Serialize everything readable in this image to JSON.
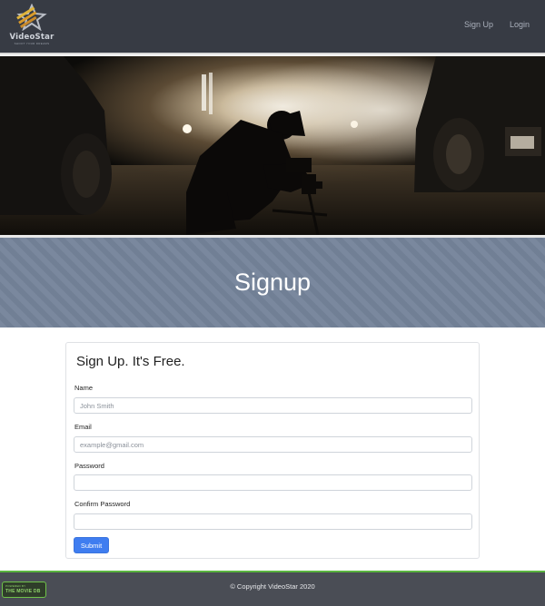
{
  "brand": {
    "name": "VideoStar",
    "tagline": "SHOOT YOUR DREAMS"
  },
  "nav": {
    "links": [
      {
        "label": "Sign Up"
      },
      {
        "label": "Login"
      }
    ]
  },
  "hero": {
    "image_description": "cameraman-kneeling-silhouette"
  },
  "banner": {
    "title": "Signup"
  },
  "form": {
    "title": "Sign Up. It's Free.",
    "fields": [
      {
        "label": "Name",
        "placeholder": "John Smith",
        "value": ""
      },
      {
        "label": "Email",
        "placeholder": "example@gmail.com",
        "value": ""
      },
      {
        "label": "Password",
        "placeholder": "",
        "value": ""
      },
      {
        "label": "Confirm Password",
        "placeholder": "",
        "value": ""
      }
    ],
    "submit_label": "Submit"
  },
  "footer": {
    "badge_small": "POWERED BY",
    "badge_big": "THE MOVIE DB",
    "copyright": "© Copyright VideoStar 2020"
  },
  "colors": {
    "navbar": "#373b44",
    "banner": "#75849a",
    "primary_button": "#3f7df0",
    "footer": "#4a4d55",
    "footer_accent": "#5ab53f"
  }
}
